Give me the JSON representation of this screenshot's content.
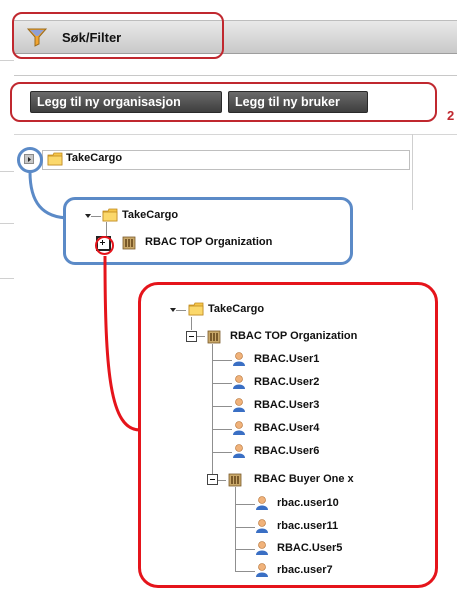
{
  "filter": {
    "title": "Søk/Filter",
    "icon": "filter-funnel-icon"
  },
  "toolbar": {
    "add_org_label": "Legg til ny organisasjon",
    "add_user_label": "Legg til ny bruker",
    "marker": "2"
  },
  "tree": {
    "root_label": "TakeCargo",
    "callout1": {
      "root": "TakeCargo",
      "child": "RBAC TOP Organization"
    },
    "callout2": {
      "root": "TakeCargo",
      "org": "RBAC TOP Organization",
      "users": [
        "RBAC.User1",
        "RBAC.User2",
        "RBAC.User3",
        "RBAC.User4",
        "RBAC.User6"
      ],
      "suborg": "RBAC Buyer One x",
      "subusers": [
        "rbac.user10",
        "rbac.user11",
        "RBAC.User5",
        "rbac.user7"
      ]
    }
  },
  "colors": {
    "highlight_red": "#e5141b",
    "highlight_blue": "#5b8ac7"
  }
}
